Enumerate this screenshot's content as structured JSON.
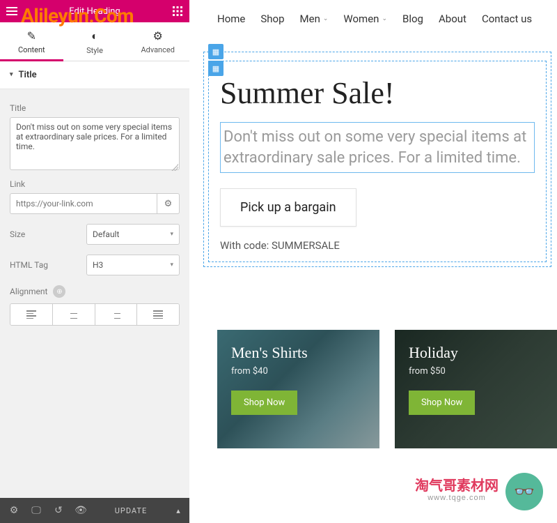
{
  "watermark_top": "Alileyun.Com",
  "topbar": {
    "title": "Edit Heading"
  },
  "tabs": {
    "content": "Content",
    "style": "Style",
    "advanced": "Advanced"
  },
  "section": {
    "title": "Title"
  },
  "fields": {
    "title_label": "Title",
    "title_value": "Don't miss out on some very special items at extraordinary sale prices. For a limited time.",
    "link_label": "Link",
    "link_placeholder": "https://your-link.com",
    "size_label": "Size",
    "size_value": "Default",
    "htmltag_label": "HTML Tag",
    "htmltag_value": "H3",
    "alignment_label": "Alignment"
  },
  "footer": {
    "update": "UPDATE"
  },
  "nav": {
    "home": "Home",
    "shop": "Shop",
    "men": "Men",
    "women": "Women",
    "blog": "Blog",
    "about": "About",
    "contact": "Contact us"
  },
  "hero": {
    "heading": "Summer Sale!",
    "subtext": "Don't miss out on some very special items at extraordinary sale prices. For a limited time.",
    "cta": "Pick up a bargain",
    "code": "With code: SUMMERSALE"
  },
  "cards": [
    {
      "title": "Men's Shirts",
      "price": "from $40",
      "btn": "Shop Now"
    },
    {
      "title": "Holiday",
      "price": "from $50",
      "btn": "Shop Now"
    }
  ],
  "wm_bottom": {
    "line1": "淘气哥素材网",
    "line2": "www.tqge.com"
  }
}
